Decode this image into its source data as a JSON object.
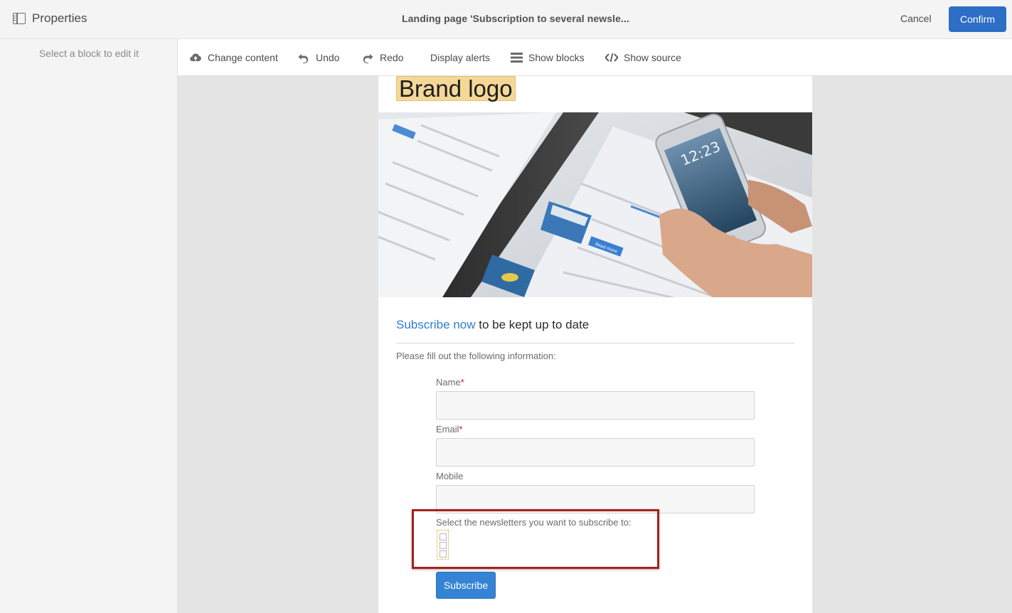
{
  "header": {
    "properties_label": "Properties",
    "title": "Landing page 'Subscription to several newsle...",
    "cancel_label": "Cancel",
    "confirm_label": "Confirm"
  },
  "left_panel": {
    "hint": "Select a block to edit it"
  },
  "toolbar": {
    "change_content": "Change content",
    "undo": "Undo",
    "redo": "Redo",
    "display_alerts": "Display alerts",
    "show_blocks": "Show blocks",
    "show_source": "Show source"
  },
  "page": {
    "brand_logo": "Brand logo",
    "headline_accent": "Subscribe now",
    "headline_rest": " to be kept up to date",
    "intro": "Please fill out the following information:",
    "fields": {
      "name_label": "Name",
      "email_label": "Email",
      "mobile_label": "Mobile",
      "required_mark": "*"
    },
    "newsletters_label": "Select the newsletters you want to subscribe to:",
    "subscribe_label": "Subscribe"
  },
  "hero_image": {
    "phone_time": "12:23",
    "card_button": "Read more"
  },
  "colors": {
    "accent": "#2d6ec6",
    "link": "#2d7ed0",
    "highlight_border": "#a7201e",
    "brand_bg": "#f5d898"
  }
}
